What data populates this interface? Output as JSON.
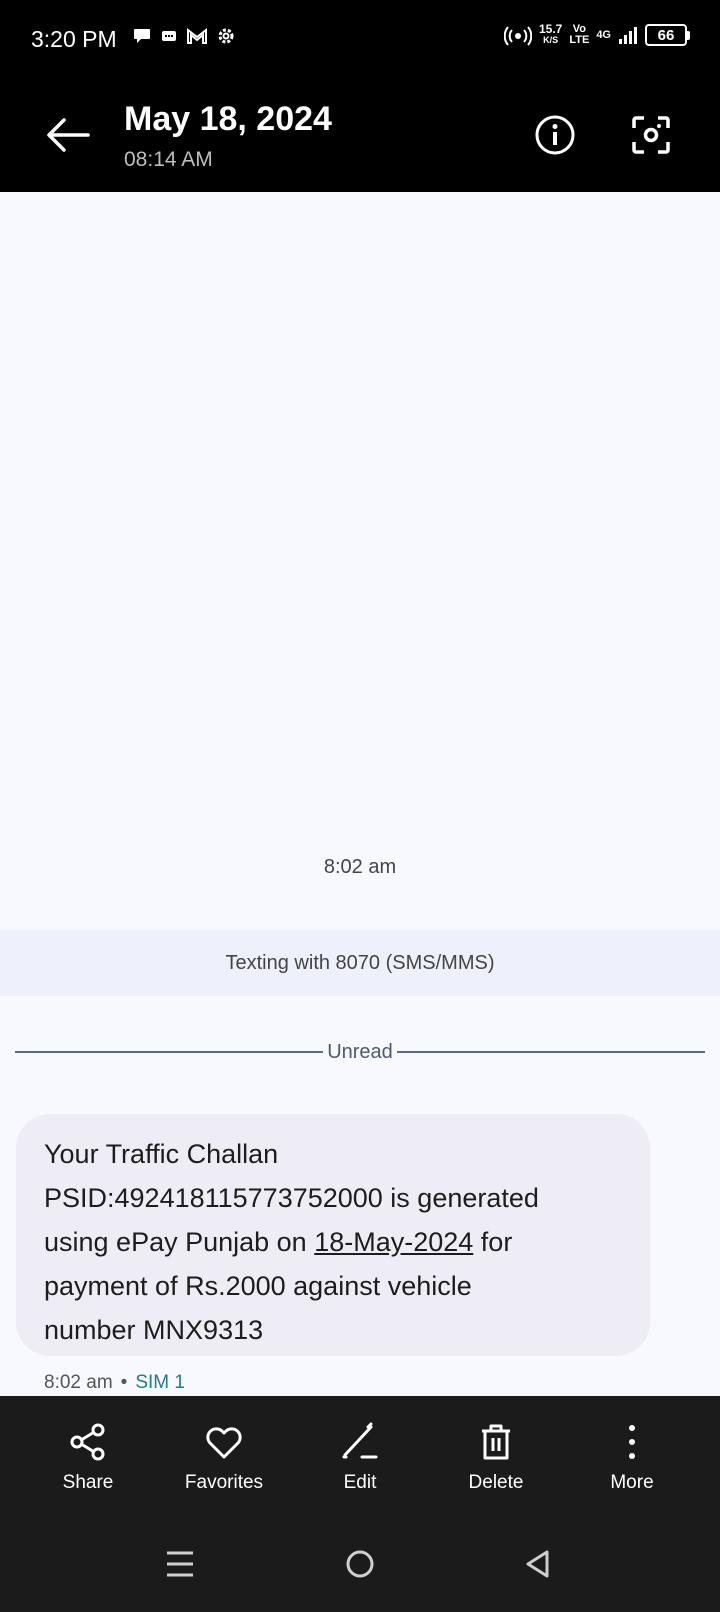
{
  "status": {
    "time": "3:20 PM",
    "speed_value": "15.7",
    "speed_unit": "K/S",
    "volte_top": "Vo",
    "volte_bottom": "LTE",
    "network_type": "4G",
    "battery": "66"
  },
  "header": {
    "title": "May 18, 2024",
    "subtitle": "08:14 AM"
  },
  "conversation": {
    "time_divider": "8:02 am",
    "texting_banner": "Texting with 8070 (SMS/MMS)",
    "unread_label": "Unread",
    "message": {
      "line1": "Your Traffic Challan",
      "line2": "PSID:492418115773752000 is generated",
      "line3_prefix": "using ePay Punjab on ",
      "line3_date": "18-May-2024",
      "line3_suffix": " for",
      "line4": "payment of Rs.2000 against vehicle",
      "line5": "number MNX9313",
      "time": "8:02 am",
      "separator": "•",
      "sim": "SIM 1"
    }
  },
  "actions": {
    "share": "Share",
    "favorites": "Favorites",
    "edit": "Edit",
    "delete": "Delete",
    "more": "More"
  },
  "colors": {
    "background": "#f8f9ff",
    "bubble": "#eeedf5",
    "sim_accent": "#1b7f8c",
    "bar_dark": "#1b1b1b"
  }
}
